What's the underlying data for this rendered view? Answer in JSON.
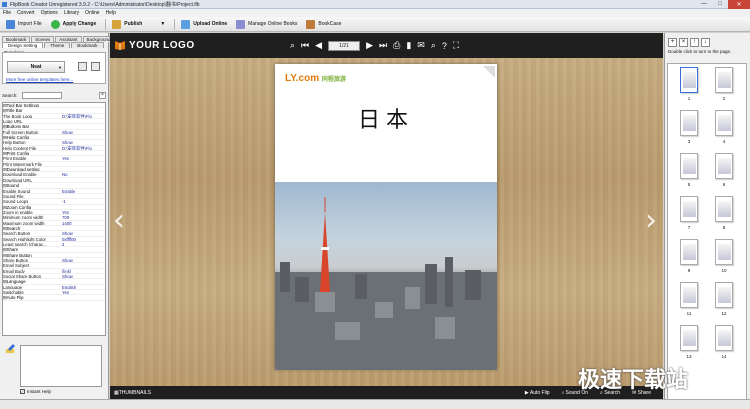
{
  "window": {
    "title": "FlipBook Creator Unregistered 3.9.2  -  C:\\Users\\Administrator\\Desktop\\翻书\\Project.flb",
    "min": "—",
    "max": "□",
    "close": "✕"
  },
  "menu": [
    "File",
    "Convert",
    "Options",
    "Library",
    "Online",
    "Help"
  ],
  "toolbar": {
    "import": "Import File",
    "apply": "Apply Change",
    "publish": "Publish",
    "upload": "Upload Online",
    "manage": "Manage Online Books",
    "bookcase": "BookCase"
  },
  "left": {
    "tabs_row1": [
      "Bookmark Tabs",
      "Scenes",
      "Assistant",
      "Background"
    ],
    "tabs_row2": [
      "Design Setting",
      "Theme",
      "Bookmark"
    ],
    "templates_label": "Templates",
    "template_name": "Neat",
    "more_link": "More free online templates here...",
    "search_label": "Search:",
    "clear": "×",
    "settings": [
      {
        "k": "⊟Tool Bar Settings",
        "v": "",
        "g": 1
      },
      {
        "k": "  ⊟Title Bar",
        "v": "",
        "g": 1
      },
      {
        "k": "      The Book Logo",
        "v": "D:\\安装软件\\Flo",
        "g": 0
      },
      {
        "k": "      Logo URL",
        "v": "",
        "g": 0
      },
      {
        "k": "  ⊟Buttons Bar",
        "v": "",
        "g": 1
      },
      {
        "k": "      Full Screen Button",
        "v": "Show",
        "g": 0
      },
      {
        "k": "    ⊟Help Config",
        "v": "",
        "g": 1
      },
      {
        "k": "      Help Button",
        "v": "Show",
        "g": 0
      },
      {
        "k": "      Help Content File",
        "v": "D:\\安装软件\\Flo",
        "g": 0
      },
      {
        "k": "    ⊟Print Config",
        "v": "",
        "g": 1
      },
      {
        "k": "      Print Enable",
        "v": "Yes",
        "g": 0
      },
      {
        "k": "      Print Watermark File",
        "v": "",
        "g": 0
      },
      {
        "k": "    ⊟Download setting",
        "v": "",
        "g": 1
      },
      {
        "k": "      Download Enable",
        "v": "No",
        "g": 0
      },
      {
        "k": "      Download URL",
        "v": "",
        "g": 0
      },
      {
        "k": "    ⊟Sound",
        "v": "",
        "g": 1
      },
      {
        "k": "      Enable Sound",
        "v": "Enable",
        "g": 0
      },
      {
        "k": "      Sound File",
        "v": "",
        "g": 0
      },
      {
        "k": "      Sound Loops",
        "v": "-1",
        "g": 0
      },
      {
        "k": "    ⊟Zoom Config",
        "v": "",
        "g": 1
      },
      {
        "k": "      Zoom in enable",
        "v": "Yes",
        "g": 0
      },
      {
        "k": "      Minimum zoom width",
        "v": "700",
        "g": 0
      },
      {
        "k": "      Maximum zoom width",
        "v": "1400",
        "g": 0
      },
      {
        "k": "    ⊟Search",
        "v": "",
        "g": 1
      },
      {
        "k": "      Search Button",
        "v": "Show",
        "g": 0
      },
      {
        "k": "      Search Highlight Color",
        "v": "0xffff00",
        "g": 0
      },
      {
        "k": "      Least search (charac...",
        "v": "3",
        "g": 0
      },
      {
        "k": "    ⊟Share",
        "v": "",
        "g": 1
      },
      {
        "k": "      ⊟Share Button",
        "v": "",
        "g": 1
      },
      {
        "k": "        Share Button",
        "v": "Show",
        "g": 0
      },
      {
        "k": "        Email Subject",
        "v": "",
        "g": 0
      },
      {
        "k": "        Email Body",
        "v": "{link}",
        "g": 0
      },
      {
        "k": "        Social Share Button",
        "v": "Show",
        "g": 0
      },
      {
        "k": "    ⊟Language",
        "v": "",
        "g": 1
      },
      {
        "k": "      Language",
        "v": "English",
        "g": 0
      },
      {
        "k": "      Switchable",
        "v": "Yes",
        "g": 0
      },
      {
        "k": "    ⊟Auto Flip",
        "v": "",
        "g": 1
      }
    ],
    "instant_help": "Instant Help"
  },
  "viewer": {
    "logo": "YOUR LOGO",
    "page_indicator": "1/21",
    "cover_title": "日本",
    "cover_brand": "LY.com",
    "cover_brand_sub": "同程旅游",
    "thumbnails_label": "THUMBNAILS",
    "auto_flip": "Auto Flip",
    "sound_on": "Sound On",
    "search": "Search",
    "share": "Share"
  },
  "right": {
    "hint": "Double click to turn to the page.",
    "pages": [
      "1",
      "2",
      "3",
      "4",
      "5",
      "6",
      "7",
      "8",
      "9",
      "10",
      "11",
      "12",
      "13",
      "14"
    ]
  },
  "watermark": "极速下载站",
  "colors": {
    "accent": "#1f1f1f",
    "link": "#1a3fc7"
  }
}
